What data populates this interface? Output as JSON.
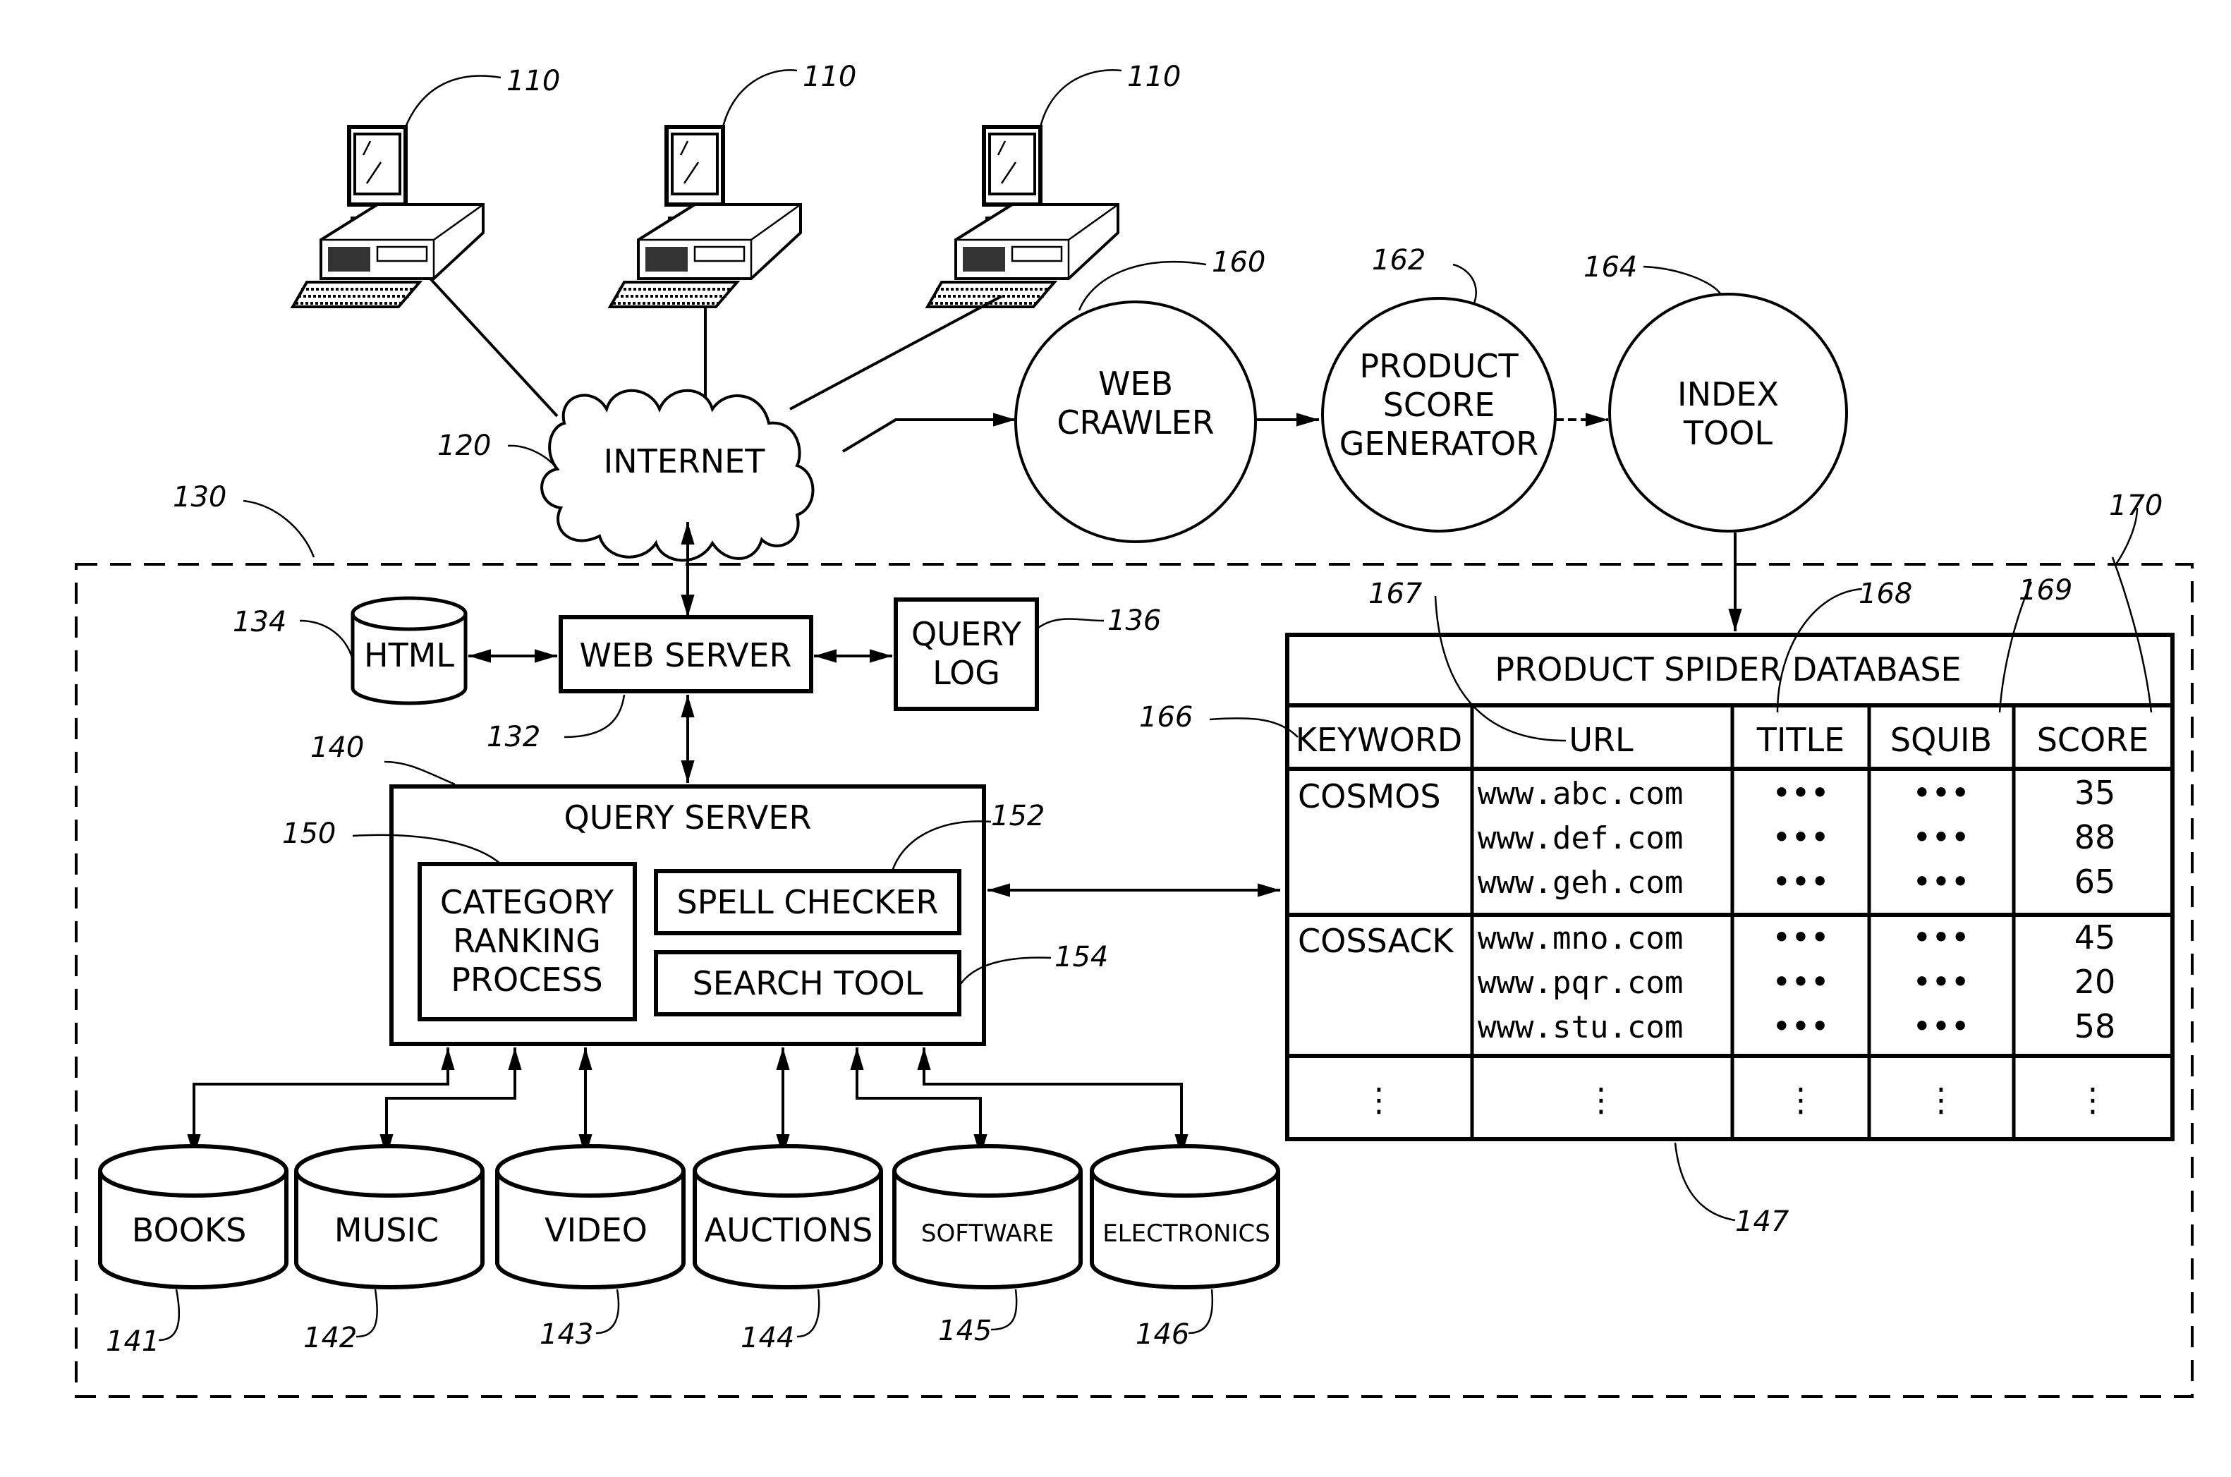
{
  "clients": [
    {
      "ref": "110"
    },
    {
      "ref": "110"
    },
    {
      "ref": "110"
    }
  ],
  "internet": {
    "label": "INTERNET",
    "ref": "120"
  },
  "crawler_pipeline": [
    {
      "label_lines": [
        "WEB",
        "CRAWLER"
      ],
      "ref": "160"
    },
    {
      "label_lines": [
        "PRODUCT",
        "SCORE",
        "GENERATOR"
      ],
      "ref": "162"
    },
    {
      "label_lines": [
        "INDEX",
        "TOOL"
      ],
      "ref": "164"
    }
  ],
  "system": {
    "ref": "130"
  },
  "html_store": {
    "label": "HTML",
    "ref": "134"
  },
  "web_server": {
    "label": "WEB  SERVER",
    "ref": "132"
  },
  "query_log": {
    "label_lines": [
      "QUERY",
      "LOG"
    ],
    "ref": "136"
  },
  "query_server": {
    "label": "QUERY  SERVER",
    "ref": "140",
    "category_ranking": {
      "label_lines": [
        "CATEGORY",
        "RANKING",
        "PROCESS"
      ],
      "ref": "150"
    },
    "spell_checker": {
      "label": "SPELL  CHECKER",
      "ref": "152"
    },
    "search_tool": {
      "label": "SEARCH  TOOL",
      "ref": "154"
    }
  },
  "databases": [
    {
      "label": "BOOKS",
      "ref": "141"
    },
    {
      "label": "MUSIC",
      "ref": "142"
    },
    {
      "label": "VIDEO",
      "ref": "143"
    },
    {
      "label": "AUCTIONS",
      "ref": "144"
    },
    {
      "label": "SOFTWARE",
      "ref": "145"
    },
    {
      "label": "ELECTRONICS",
      "ref": "146"
    }
  ],
  "product_db": {
    "title": "PRODUCT  SPIDER  DATABASE",
    "ref": "147",
    "table_ref": "170",
    "columns": [
      {
        "label": "KEYWORD",
        "ref": "166"
      },
      {
        "label": "URL",
        "ref": "167"
      },
      {
        "label": "TITLE",
        "ref": "168"
      },
      {
        "label": "SQUIB",
        "ref": "169"
      },
      {
        "label": "SCORE",
        "ref": ""
      }
    ],
    "groups": [
      {
        "keyword": "COSMOS",
        "rows": [
          {
            "url": "www.abc.com",
            "title": "•••",
            "squib": "•••",
            "score": "35"
          },
          {
            "url": "www.def.com",
            "title": "•••",
            "squib": "•••",
            "score": "88"
          },
          {
            "url": "www.geh.com",
            "title": "•••",
            "squib": "•••",
            "score": "65"
          }
        ]
      },
      {
        "keyword": "COSSACK",
        "rows": [
          {
            "url": "www.mno.com",
            "title": "•••",
            "squib": "•••",
            "score": "45"
          },
          {
            "url": "www.pqr.com",
            "title": "•••",
            "squib": "•••",
            "score": "20"
          },
          {
            "url": "www.stu.com",
            "title": "•••",
            "squib": "•••",
            "score": "58"
          }
        ]
      }
    ],
    "ellipsis": "⋮"
  }
}
